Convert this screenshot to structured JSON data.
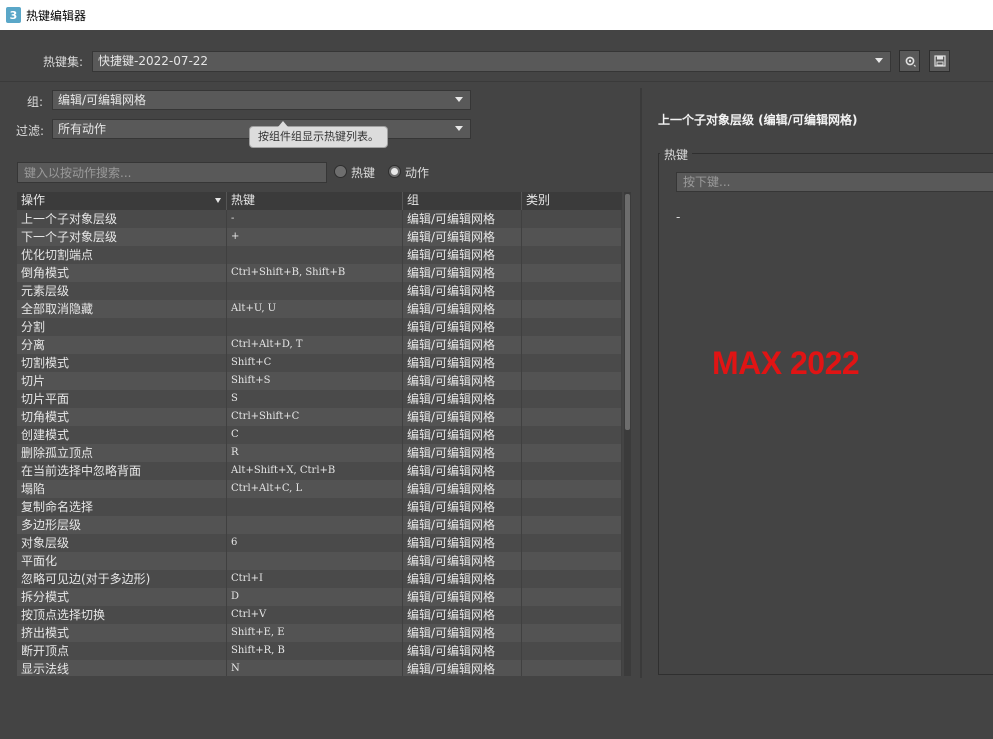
{
  "window": {
    "icon_glyph": "3",
    "title": "热键编辑器"
  },
  "topbar": {
    "set_label": "热键集:",
    "set_value": "快捷键-2022-07-22",
    "settings_icon": "gear-icon",
    "save_icon": "save-icon"
  },
  "filters": {
    "group_label": "组:",
    "group_value": "编辑/可编辑网格",
    "filter_label": "过滤:",
    "filter_value": "所有动作",
    "tooltip": "按组件组显示热键列表。"
  },
  "search": {
    "placeholder": "键入以按动作搜索...",
    "radio_hotkey": "热键",
    "radio_action": "动作",
    "selected": "动作"
  },
  "table": {
    "headers": [
      "操作",
      "热键",
      "组",
      "类别"
    ],
    "rows": [
      {
        "action": "上一个子对象层级",
        "hotkey": "-",
        "group": "编辑/可编辑网格",
        "category": ""
      },
      {
        "action": "下一个子对象层级",
        "hotkey": "+",
        "group": "编辑/可编辑网格",
        "category": ""
      },
      {
        "action": "优化切割端点",
        "hotkey": "",
        "group": "编辑/可编辑网格",
        "category": ""
      },
      {
        "action": "倒角模式",
        "hotkey": "Ctrl+Shift+B, Shift+B",
        "group": "编辑/可编辑网格",
        "category": ""
      },
      {
        "action": "元素层级",
        "hotkey": "",
        "group": "编辑/可编辑网格",
        "category": ""
      },
      {
        "action": "全部取消隐藏",
        "hotkey": "Alt+U, U",
        "group": "编辑/可编辑网格",
        "category": ""
      },
      {
        "action": "分割",
        "hotkey": "",
        "group": "编辑/可编辑网格",
        "category": ""
      },
      {
        "action": "分离",
        "hotkey": "Ctrl+Alt+D, T",
        "group": "编辑/可编辑网格",
        "category": ""
      },
      {
        "action": "切割模式",
        "hotkey": "Shift+C",
        "group": "编辑/可编辑网格",
        "category": ""
      },
      {
        "action": "切片",
        "hotkey": "Shift+S",
        "group": "编辑/可编辑网格",
        "category": ""
      },
      {
        "action": "切片平面",
        "hotkey": "S",
        "group": "编辑/可编辑网格",
        "category": ""
      },
      {
        "action": "切角模式",
        "hotkey": "Ctrl+Shift+C",
        "group": "编辑/可编辑网格",
        "category": ""
      },
      {
        "action": "创建模式",
        "hotkey": "C",
        "group": "编辑/可编辑网格",
        "category": ""
      },
      {
        "action": "删除孤立顶点",
        "hotkey": "R",
        "group": "编辑/可编辑网格",
        "category": ""
      },
      {
        "action": "在当前选择中忽略背面",
        "hotkey": "Alt+Shift+X, Ctrl+B",
        "group": "编辑/可编辑网格",
        "category": ""
      },
      {
        "action": "塌陷",
        "hotkey": "Ctrl+Alt+C, L",
        "group": "编辑/可编辑网格",
        "category": ""
      },
      {
        "action": "复制命名选择",
        "hotkey": "",
        "group": "编辑/可编辑网格",
        "category": ""
      },
      {
        "action": "多边形层级",
        "hotkey": "",
        "group": "编辑/可编辑网格",
        "category": ""
      },
      {
        "action": "对象层级",
        "hotkey": "6",
        "group": "编辑/可编辑网格",
        "category": ""
      },
      {
        "action": "平面化",
        "hotkey": "",
        "group": "编辑/可编辑网格",
        "category": ""
      },
      {
        "action": "忽略可见边(对于多边形)",
        "hotkey": "Ctrl+I",
        "group": "编辑/可编辑网格",
        "category": ""
      },
      {
        "action": "拆分模式",
        "hotkey": "D",
        "group": "编辑/可编辑网格",
        "category": ""
      },
      {
        "action": "按顶点选择切换",
        "hotkey": "Ctrl+V",
        "group": "编辑/可编辑网格",
        "category": ""
      },
      {
        "action": "挤出模式",
        "hotkey": "Shift+E, E",
        "group": "编辑/可编辑网格",
        "category": ""
      },
      {
        "action": "断开顶点",
        "hotkey": "Shift+R, B",
        "group": "编辑/可编辑网格",
        "category": ""
      },
      {
        "action": "显示法线",
        "hotkey": "N",
        "group": "编辑/可编辑网格",
        "category": ""
      }
    ]
  },
  "detail": {
    "title": "上一个子对象层级 (编辑/可编辑网格)",
    "hotkey_group_label": "热键",
    "hotkey_placeholder": "按下键...",
    "current_hotkey": "-",
    "watermark": "MAX 2022",
    "watermark_color": "#e01414"
  }
}
